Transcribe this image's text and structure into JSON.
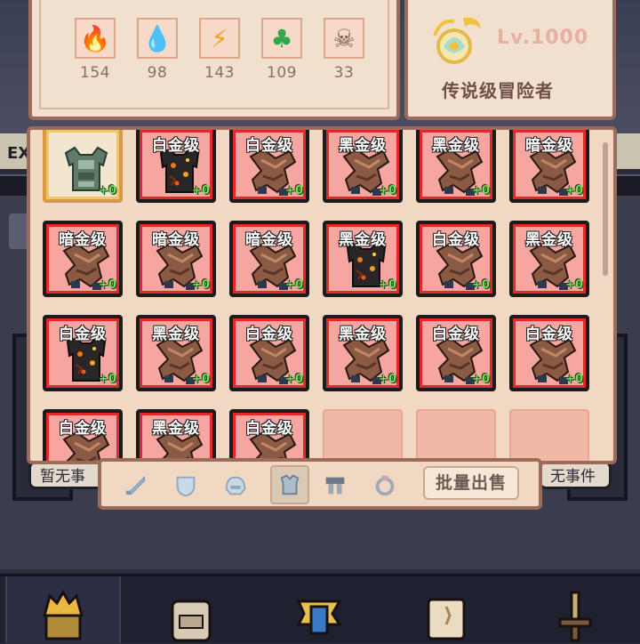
{
  "background": {
    "ex_label": "EX",
    "left_event": "暂无事",
    "right_event": "无事件"
  },
  "resources": [
    {
      "icon": "fire-gem-icon",
      "glyph": "🔥",
      "color": "#e03a1a",
      "count": "154"
    },
    {
      "icon": "water-gem-icon",
      "glyph": "💧",
      "color": "#2a8ee6",
      "count": "98"
    },
    {
      "icon": "lightning-gem-icon",
      "glyph": "⚡",
      "color": "#f0a020",
      "count": "143"
    },
    {
      "icon": "nature-gem-icon",
      "glyph": "♣",
      "color": "#2ea84a",
      "count": "109"
    },
    {
      "icon": "skull-gem-icon",
      "glyph": "☠",
      "color": "#7a5a54",
      "count": "33"
    }
  ],
  "player": {
    "level": "Lv.1000",
    "rank": "传说级冒险者",
    "emblem": "golden-crest-icon"
  },
  "inventory": {
    "rows": [
      [
        {
          "tier": "",
          "plus": "+0",
          "kind": "green-armor",
          "selected": true
        },
        {
          "tier": "白金级",
          "plus": "+0",
          "kind": "dark-armor"
        },
        {
          "tier": "白金级",
          "plus": "+0",
          "kind": "brown-armor"
        },
        {
          "tier": "黑金级",
          "plus": "+0",
          "kind": "brown-armor"
        },
        {
          "tier": "黑金级",
          "plus": "+0",
          "kind": "brown-armor"
        },
        {
          "tier": "暗金级",
          "plus": "+0",
          "kind": "brown-armor"
        }
      ],
      [
        {
          "tier": "暗金级",
          "plus": "+0",
          "kind": "brown-armor"
        },
        {
          "tier": "暗金级",
          "plus": "+0",
          "kind": "brown-armor"
        },
        {
          "tier": "暗金级",
          "plus": "+0",
          "kind": "brown-armor"
        },
        {
          "tier": "黑金级",
          "plus": "+0",
          "kind": "dark-armor"
        },
        {
          "tier": "白金级",
          "plus": "+0",
          "kind": "brown-armor"
        },
        {
          "tier": "黑金级",
          "plus": "+0",
          "kind": "brown-armor"
        }
      ],
      [
        {
          "tier": "白金级",
          "plus": "+0",
          "kind": "dark-armor"
        },
        {
          "tier": "黑金级",
          "plus": "+0",
          "kind": "brown-armor"
        },
        {
          "tier": "白金级",
          "plus": "+0",
          "kind": "brown-armor"
        },
        {
          "tier": "黑金级",
          "plus": "+0",
          "kind": "brown-armor"
        },
        {
          "tier": "白金级",
          "plus": "+0",
          "kind": "brown-armor"
        },
        {
          "tier": "白金级",
          "plus": "+0",
          "kind": "brown-armor"
        }
      ],
      [
        {
          "tier": "白金级",
          "plus": "",
          "kind": "brown-armor"
        },
        {
          "tier": "黑金级",
          "plus": "",
          "kind": "brown-armor"
        },
        {
          "tier": "白金级",
          "plus": "",
          "kind": "brown-armor"
        },
        {
          "tier": "",
          "plus": "",
          "kind": "empty"
        },
        {
          "tier": "",
          "plus": "",
          "kind": "empty"
        },
        {
          "tier": "",
          "plus": "",
          "kind": "empty"
        }
      ]
    ]
  },
  "tabs": [
    {
      "icon": "sword-icon",
      "active": false
    },
    {
      "icon": "shield-icon",
      "active": false
    },
    {
      "icon": "helmet-icon",
      "active": false
    },
    {
      "icon": "armor-icon",
      "active": true
    },
    {
      "icon": "boots-icon",
      "active": false
    },
    {
      "icon": "ring-icon",
      "active": false
    }
  ],
  "sell_button": "批量出售",
  "bottom_nav": [
    {
      "icon": "crown-helmet-icon",
      "selected": true
    },
    {
      "icon": "backpack-icon",
      "selected": false
    },
    {
      "icon": "guild-banner-icon",
      "selected": false
    },
    {
      "icon": "spellbook-icon",
      "selected": false
    },
    {
      "icon": "sword-hilt-icon",
      "selected": false
    }
  ]
}
